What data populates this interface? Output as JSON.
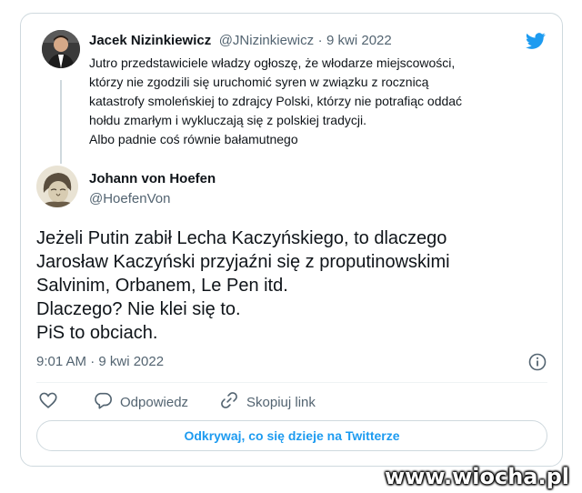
{
  "parent_tweet": {
    "author_name": "Jacek Nizinkiewicz",
    "handle": "@JNizinkiewicz",
    "separator": "·",
    "date": "9 kwi 2022",
    "text_lines": [
      "Jutro przedstawiciele władzy ogłoszę, że włodarze miejscowości,",
      "którzy nie zgodzili się uruchomić syren w związku z rocznicą",
      "katastrofy smoleńskiej to zdrajcy Polski, którzy nie potrafiąc oddać",
      "hołdu zmarłym i wykluczają się z polskiej tradycji.",
      "Albo padnie coś równie bałamutnego"
    ]
  },
  "reply_tweet": {
    "author_name": "Johann von Hoefen",
    "handle": "@HoefenVon",
    "text_lines": [
      "Jeżeli Putin zabił Lecha Kaczyńskiego, to dlaczego",
      "Jarosław Kaczyński przyjaźni się z proputinowskimi",
      "Salvinim, Orbanem, Le Pen itd.",
      "Dlaczego? Nie klei się to.",
      "PiS to obciach."
    ],
    "timestamp": "9:01 AM · 9 kwi 2022"
  },
  "actions": {
    "reply_label": "Odpowiedz",
    "copy_link_label": "Skopiuj link"
  },
  "cta_label": "Odkrywaj, co się dzieje na Twitterze",
  "watermark": "www.wiocha.pl",
  "colors": {
    "twitter_blue": "#1d9bf0",
    "muted": "#536471",
    "border": "#cfd9de"
  },
  "icons": [
    "twitter-bird-icon",
    "info-icon",
    "heart-icon",
    "reply-icon",
    "link-icon"
  ]
}
